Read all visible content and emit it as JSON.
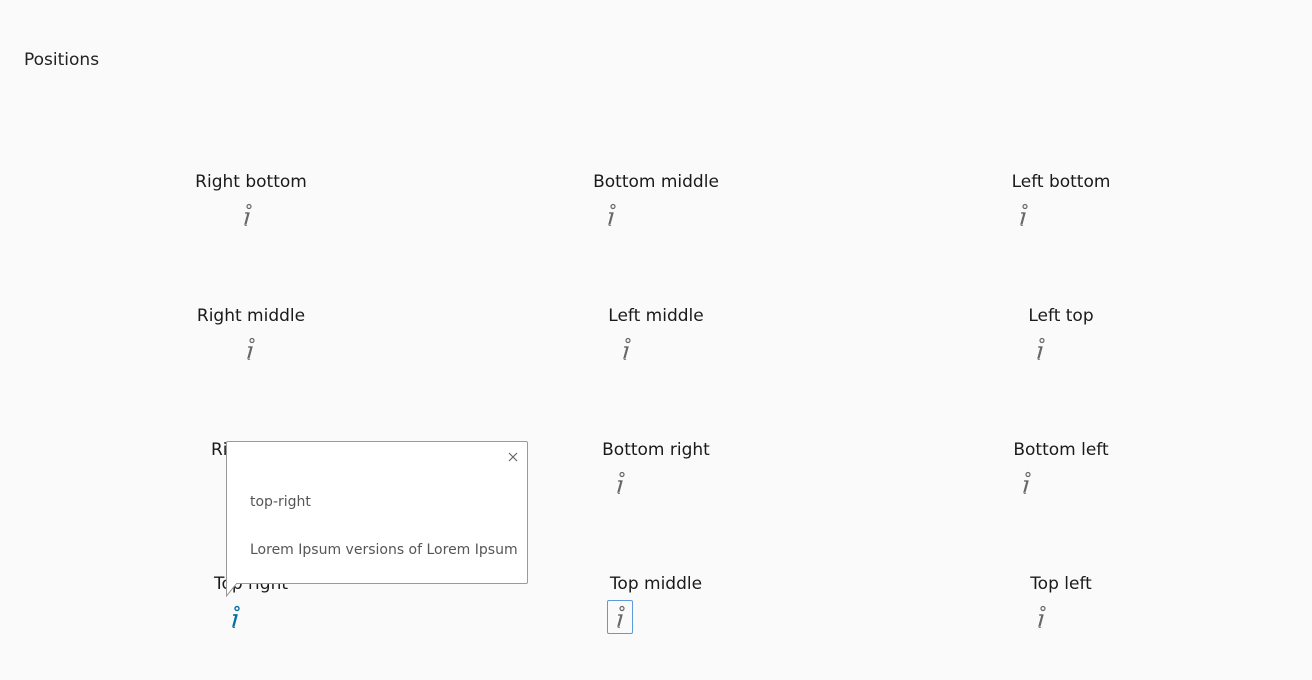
{
  "page": {
    "title": "Positions"
  },
  "positions": {
    "right_bottom": "Right bottom",
    "bottom_middle": "Bottom middle",
    "left_bottom": "Left bottom",
    "right_middle": "Right middle",
    "left_middle": "Left middle",
    "left_top": "Left top",
    "right_top": "Ri",
    "bottom_right": "Bottom right",
    "bottom_left": "Bottom left",
    "top_right": "Top right",
    "top_middle": "Top middle",
    "top_left": "Top left"
  },
  "popover": {
    "title": "top-right",
    "body": "Lorem Ipsum versions of Lorem Ipsum",
    "close_icon": "close-icon"
  },
  "icons": {
    "trigger": "info-icon"
  },
  "colors": {
    "active_icon": "#0072a3",
    "icon": "#666666",
    "focus_ring": "#5d9bd6"
  }
}
